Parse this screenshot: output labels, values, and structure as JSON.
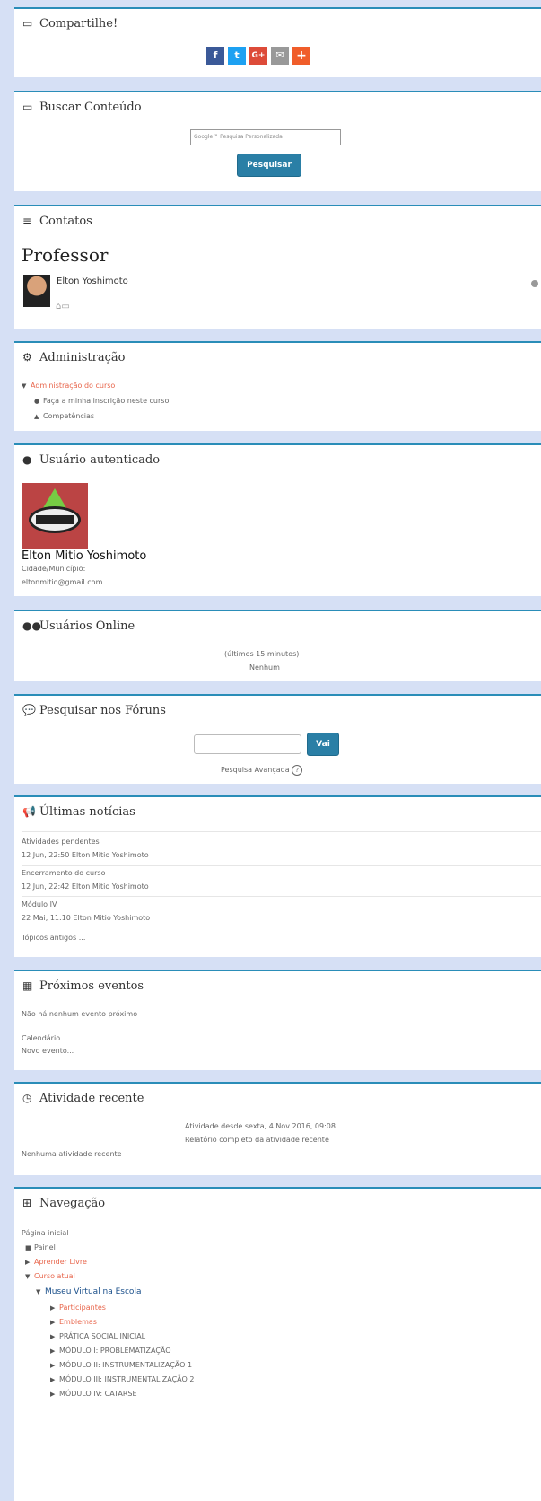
{
  "share": {
    "title": "Compartilhe!",
    "buttons": [
      "facebook",
      "twitter",
      "google-plus",
      "email",
      "more"
    ],
    "colors": [
      "#3b5998",
      "#1da1f2",
      "#dd4b39",
      "#999999",
      "#f05d2a"
    ]
  },
  "search": {
    "title": "Buscar Conteúdo",
    "placeholder_brand": "Google™",
    "placeholder": "Pesquisa Personalizada",
    "button": "Pesquisar"
  },
  "contacts": {
    "title": "Contatos",
    "heading": "Professor",
    "name": "Elton Yoshimoto"
  },
  "admin": {
    "title": "Administração",
    "root": "Administração do curso",
    "items": [
      "Faça a minha inscrição neste curso",
      "Competências"
    ]
  },
  "auth": {
    "title": "Usuário autenticado",
    "name": "Elton Mitio Yoshimoto",
    "city": "Cidade/Município:",
    "email": "eltonmitio@gmail.com"
  },
  "online": {
    "title": "Usuários Online",
    "period": "(últimos 15 minutos)",
    "status": "Nenhum"
  },
  "forum": {
    "title": "Pesquisar nos Fóruns",
    "button": "Vai",
    "advanced": "Pesquisa Avançada"
  },
  "news": {
    "title": "Últimas notícias",
    "items": [
      {
        "subject": "Atividades pendentes",
        "meta": "12 Jun, 22:50  Elton Mitio Yoshimoto"
      },
      {
        "subject": "Encerramento do curso",
        "meta": "12 Jun, 22:42  Elton Mitio Yoshimoto"
      },
      {
        "subject": "Módulo IV",
        "meta": "22 Mai, 11:10  Elton Mitio Yoshimoto"
      }
    ],
    "older": "Tópicos antigos ..."
  },
  "events": {
    "title": "Próximos eventos",
    "empty": "Não há nenhum evento próximo",
    "calendar": "Calendário...",
    "new": "Novo evento..."
  },
  "recent": {
    "title": "Atividade recente",
    "since": "Atividade desde sexta, 4 Nov 2016, 09:08",
    "full": "Relatório completo da atividade recente",
    "empty": "Nenhuma atividade recente"
  },
  "nav": {
    "title": "Navegação",
    "home": "Página inicial",
    "dashboard": "Painel",
    "free": "Aprender Livre",
    "current": "Curso atual",
    "course": "Museu Virtual na Escola",
    "items": [
      "Participantes",
      "Emblemas",
      "PRÁTICA SOCIAL INICIAL",
      "MÓDULO I: PROBLEMATIZAÇÃO",
      "MÓDULO II: INSTRUMENTALIZAÇÃO 1",
      "MÓDULO III: INSTRUMENTALIZAÇÃO 2",
      "MÓDULO IV: CATARSE"
    ]
  }
}
